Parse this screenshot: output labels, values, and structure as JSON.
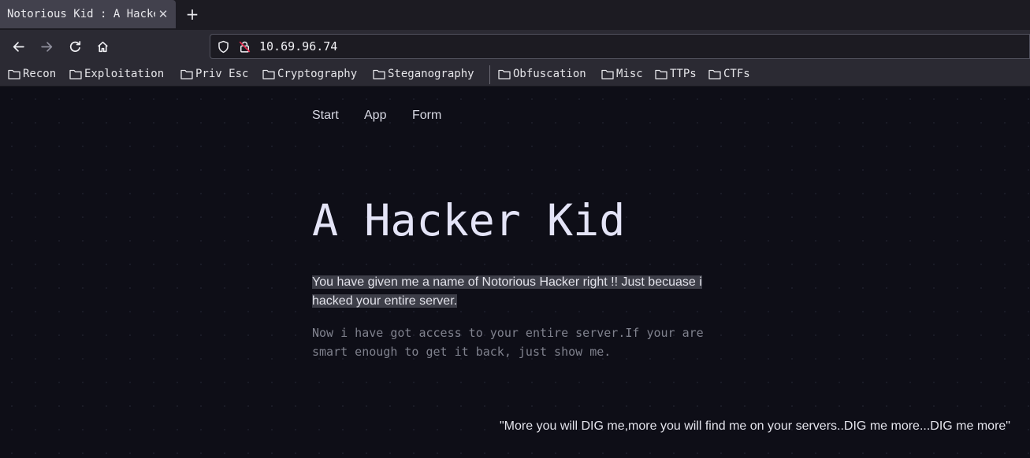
{
  "browser": {
    "tab": {
      "title": "Notorious Kid : A Hacker Kid",
      "close_glyph": "✕"
    },
    "new_tab_glyph": "+",
    "url": "10.69.96.74",
    "icons": {
      "back": "arrow-left-icon",
      "forward": "arrow-right-icon",
      "reload": "reload-icon",
      "home": "home-icon",
      "shield": "shield-icon",
      "insecure_lock": "insecure-lock-icon",
      "folder": "folder-icon"
    },
    "colors": {
      "lock_slash": "#e2254a"
    }
  },
  "bookmarks": [
    {
      "label": "Recon"
    },
    {
      "label": "Exploitation"
    },
    {
      "label": "Priv Esc"
    },
    {
      "label": "Cryptography"
    },
    {
      "label": "Steganography"
    },
    {
      "label": "Obfuscation"
    },
    {
      "label": "Misc"
    },
    {
      "label": "TTPs"
    },
    {
      "label": "CTFs"
    }
  ],
  "site": {
    "nav": [
      {
        "label": "Start"
      },
      {
        "label": "App"
      },
      {
        "label": "Form"
      }
    ],
    "title": "A Hacker Kid",
    "lead_line1": "You have given me a name of Notorious Hacker right !! Just becuase i",
    "lead_line2": "hacked your entire server.",
    "subtext_line1": "Now i have got access to your entire server.If your are",
    "subtext_line2": "smart enough to get it back, just show me.",
    "quote": "\"More you will DIG me,more you will find me on your servers..DIG me more...DIG me more\""
  }
}
